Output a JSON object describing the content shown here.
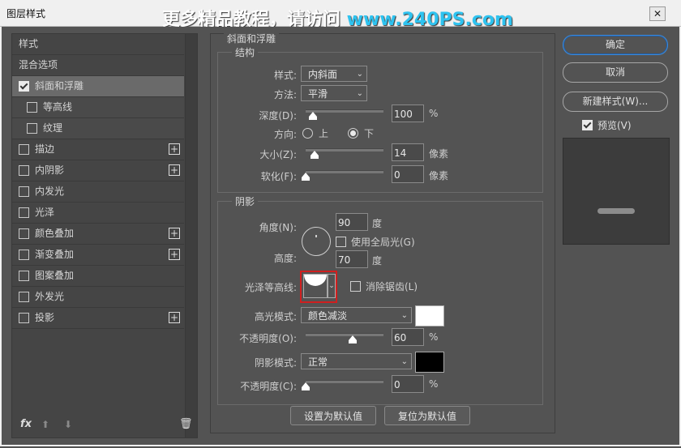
{
  "window": {
    "title": "图层样式",
    "close_icon": "close-icon"
  },
  "watermark": {
    "text": "更多精品教程，请访问 ",
    "url": "www.240PS.com"
  },
  "left_panel": {
    "items": [
      {
        "label": "样式",
        "checkbox": false,
        "checked": false,
        "plus": false
      },
      {
        "label": "混合选项",
        "checkbox": false,
        "checked": false,
        "plus": false
      },
      {
        "label": "斜面和浮雕",
        "checkbox": true,
        "checked": true,
        "plus": false,
        "selected": true
      },
      {
        "label": "等高线",
        "checkbox": true,
        "checked": false,
        "plus": false,
        "sub": true
      },
      {
        "label": "纹理",
        "checkbox": true,
        "checked": false,
        "plus": false,
        "sub": true
      },
      {
        "label": "描边",
        "checkbox": true,
        "checked": false,
        "plus": true
      },
      {
        "label": "内阴影",
        "checkbox": true,
        "checked": false,
        "plus": true
      },
      {
        "label": "内发光",
        "checkbox": true,
        "checked": false,
        "plus": false
      },
      {
        "label": "光泽",
        "checkbox": true,
        "checked": false,
        "plus": false
      },
      {
        "label": "颜色叠加",
        "checkbox": true,
        "checked": false,
        "plus": true
      },
      {
        "label": "渐变叠加",
        "checkbox": true,
        "checked": false,
        "plus": true
      },
      {
        "label": "图案叠加",
        "checkbox": true,
        "checked": false,
        "plus": false
      },
      {
        "label": "外发光",
        "checkbox": true,
        "checked": false,
        "plus": false
      },
      {
        "label": "投影",
        "checkbox": true,
        "checked": false,
        "plus": true
      }
    ],
    "footer": {
      "fx": "fx",
      "up_icon": "arrow-up-icon",
      "down_icon": "arrow-down-icon",
      "trash_icon": "trash-icon"
    }
  },
  "bevel": {
    "title": "斜面和浮雕",
    "structure": {
      "title": "结构",
      "style_label": "样式:",
      "style_value": "内斜面",
      "technique_label": "方法:",
      "technique_value": "平滑",
      "depth_label": "深度(D):",
      "depth_value": "100",
      "depth_unit": "%",
      "direction_label": "方向:",
      "dir_up": "上",
      "dir_down": "下",
      "direction_selected": "下",
      "size_label": "大小(Z):",
      "size_value": "14",
      "size_unit": "像素",
      "soften_label": "软化(F):",
      "soften_value": "0",
      "soften_unit": "像素"
    },
    "shading": {
      "title": "阴影",
      "angle_label": "角度(N):",
      "angle_value": "90",
      "angle_unit": "度",
      "global_light_label": "使用全局光(G)",
      "altitude_label": "高度:",
      "altitude_value": "70",
      "altitude_unit": "度",
      "gloss_label": "光泽等高线:",
      "antialias_label": "消除锯齿(L)",
      "highlight_mode_label": "高光模式:",
      "highlight_mode_value": "颜色减淡",
      "highlight_color": "#ffffff",
      "highlight_opacity_label": "不透明度(O):",
      "highlight_opacity_value": "60",
      "highlight_opacity_unit": "%",
      "shadow_mode_label": "阴影模式:",
      "shadow_mode_value": "正常",
      "shadow_color": "#000000",
      "shadow_opacity_label": "不透明度(C):",
      "shadow_opacity_value": "0",
      "shadow_opacity_unit": "%"
    },
    "buttons": {
      "set_default": "设置为默认值",
      "reset_default": "复位为默认值"
    }
  },
  "right": {
    "ok": "确定",
    "cancel": "取消",
    "new_style": "新建样式(W)...",
    "preview_label": "预览(V)"
  },
  "accent_color": "#d01f1f"
}
